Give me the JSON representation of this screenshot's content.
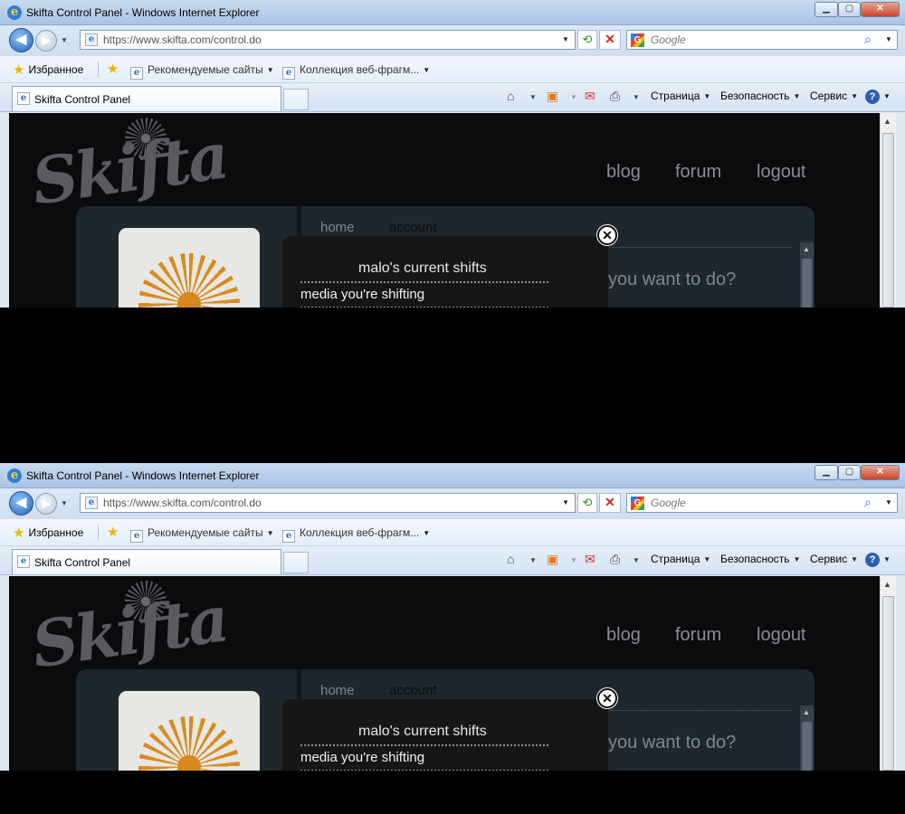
{
  "window": {
    "title": "Skifta Control Panel - Windows Internet Explorer",
    "minimize_glyph": "▁",
    "maximize_glyph": "▢",
    "close_glyph": "✕"
  },
  "navigation": {
    "back_glyph": "◀",
    "forward_glyph": "▶",
    "dropdown_glyph": "▼",
    "address": "https://www.skifta.com/control.do",
    "refresh_glyph": "⟲",
    "stop_glyph": "✕",
    "search_placeholder": "Google",
    "search_glyph": "⌕"
  },
  "favorites": {
    "favorites_label": "Избранное",
    "recommended_label": "Рекомендуемые сайты",
    "web_slices_label": "Коллекция веб-фрагм..."
  },
  "tabs": [
    {
      "label": "Skifta Control Panel"
    }
  ],
  "command_bar": {
    "page_label": "Страница",
    "safety_label": "Безопасность",
    "tools_label": "Сервис",
    "help_glyph": "?"
  },
  "page": {
    "logo_text": "Skifta",
    "top_nav": {
      "blog": "blog",
      "forum": "forum",
      "logout": "logout"
    },
    "sub_nav": {
      "home": "home",
      "account": "account"
    },
    "prompt_text": "you want to do?"
  },
  "popup": {
    "title": "malo's current shifts",
    "row": "media you're shifting",
    "close_glyph": "✕"
  },
  "colors": {
    "page_background": "#0b0b0d",
    "popup_background": "#161616",
    "accent_flower": "#d88b1f"
  }
}
